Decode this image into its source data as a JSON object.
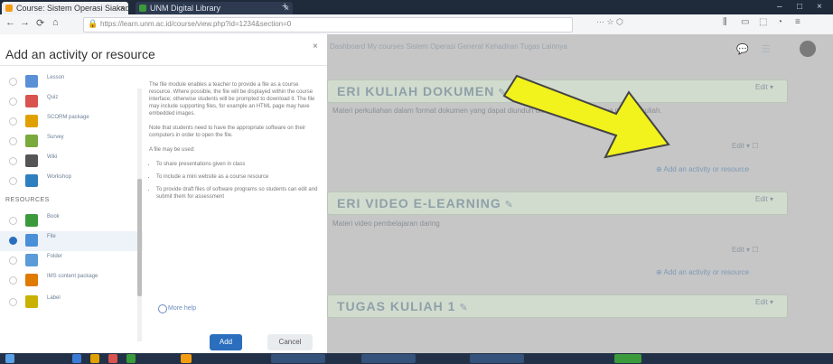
{
  "browser": {
    "tab1_title": "Course: Sistem Operasi Siakad",
    "tab2_title": "UNM Digital Library",
    "new_tab": "+",
    "tab_close": "×",
    "url": "https://learn.unm.ac.id/course/view.php?id=1234&section=0",
    "min": "–",
    "max": "□",
    "close": "×"
  },
  "toolbar": {
    "back": "←",
    "forward": "→",
    "reload": "⟳",
    "home": "⌂",
    "url_actions": "··· ☆ ⬡"
  },
  "course": {
    "breadcrumb": "Dashboard  My courses  Sistem Operasi  General  Kehadiran  Tugas  Lainnya",
    "sections": [
      {
        "title": "ERI KULIAH DOKUMEN",
        "edit_icon": "✎",
        "edit_label": "Edit ▾",
        "desc": "Materi perkuliahan dalam format dokumen yang dapat diunduh oleh seluruh mahasiswa peserta kuliah.",
        "add_label": "⊕ Add an activity or resource",
        "item_edit": "Edit ▾  ☐"
      },
      {
        "title": "ERI VIDEO E-LEARNING",
        "edit_icon": "✎",
        "edit_label": "Edit ▾",
        "desc": "Materi video pembelajaran daring",
        "add_label": "⊕ Add an activity or resource",
        "item_edit": "Edit ▾  ☐"
      },
      {
        "title": "TUGAS KULIAH 1",
        "edit_icon": "✎",
        "edit_label": "Edit ▾"
      }
    ]
  },
  "modal": {
    "title": "Add an activity or resource",
    "close": "×",
    "resources_heading": "RESOURCES",
    "items": [
      {
        "label": "Lesson",
        "color": "#5b8fd6"
      },
      {
        "label": "Quiz",
        "color": "#d9534f"
      },
      {
        "label": "SCORM package",
        "color": "#e0a100"
      },
      {
        "label": "Survey",
        "color": "#7aa93c"
      },
      {
        "label": "Wiki",
        "color": "#555555"
      },
      {
        "label": "Workshop",
        "color": "#2f7fbf"
      }
    ],
    "resources": [
      {
        "label": "Book",
        "color": "#3b9a3b"
      },
      {
        "label": "File",
        "color": "#4a90d9"
      },
      {
        "label": "Folder",
        "color": "#5a9bd8"
      },
      {
        "label": "IMS content package",
        "color": "#e07b00"
      },
      {
        "label": "Label",
        "color": "#c9b100"
      }
    ],
    "help": {
      "p1": "The file module enables a teacher to provide a file as a course resource. Where possible, the file will be displayed within the course interface; otherwise students will be prompted to download it. The file may include supporting files, for example an HTML page may have embedded images.",
      "p2": "Note that students need to have the appropriate software on their computers in order to open the file.",
      "p3": "A file may be used:",
      "li1": "To share presentations given in class",
      "li2": "To include a mini website as a course resource",
      "li3": "To provide draft files of software programs so students can edit and submit them for assessment"
    },
    "more_help": "More help",
    "add_button": "Add",
    "cancel_button": "Cancel"
  }
}
